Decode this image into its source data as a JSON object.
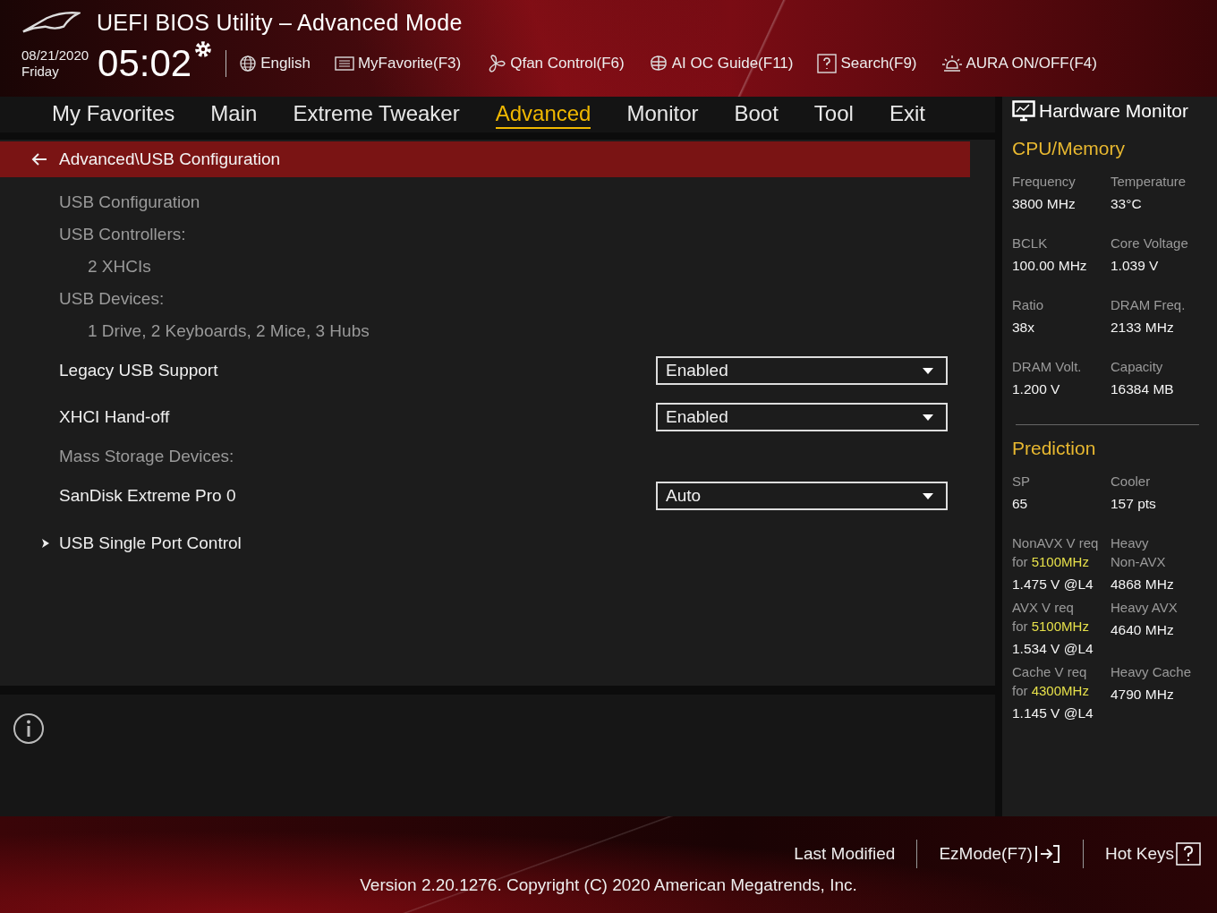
{
  "header": {
    "title": "UEFI BIOS Utility – Advanced Mode",
    "date": "08/21/2020",
    "day": "Friday",
    "time": "05:02",
    "tools": [
      {
        "label": "English"
      },
      {
        "label": "MyFavorite(F3)"
      },
      {
        "label": "Qfan Control(F6)"
      },
      {
        "label": "AI OC Guide(F11)"
      },
      {
        "label": "Search(F9)"
      },
      {
        "label": "AURA ON/OFF(F4)"
      }
    ]
  },
  "tabs": [
    {
      "label": "My Favorites",
      "selected": false
    },
    {
      "label": "Main",
      "selected": false
    },
    {
      "label": "Extreme Tweaker",
      "selected": false
    },
    {
      "label": "Advanced",
      "selected": true
    },
    {
      "label": "Monitor",
      "selected": false
    },
    {
      "label": "Boot",
      "selected": false
    },
    {
      "label": "Tool",
      "selected": false
    },
    {
      "label": "Exit",
      "selected": false
    }
  ],
  "breadcrumb": "Advanced\\USB Configuration",
  "items": [
    {
      "kind": "heading",
      "label": "USB Configuration"
    },
    {
      "kind": "heading",
      "label": "USB Controllers:",
      "children": [
        {
          "label": "2 XHCIs"
        }
      ]
    },
    {
      "kind": "heading",
      "label": "USB Devices:",
      "children": [
        {
          "label": "1 Drive, 2 Keyboards, 2 Mice, 3 Hubs"
        }
      ]
    },
    {
      "kind": "setting",
      "label": "Legacy USB Support",
      "value": "Enabled"
    },
    {
      "kind": "setting",
      "label": "XHCI Hand-off",
      "value": "Enabled"
    },
    {
      "kind": "heading",
      "label": "Mass Storage Devices:"
    },
    {
      "kind": "setting",
      "label": "SanDisk Extreme Pro 0",
      "value": "Auto"
    },
    {
      "kind": "submenu",
      "label": "USB Single Port Control"
    }
  ],
  "monitor": {
    "title": "Hardware Monitor",
    "sections": [
      {
        "title": "CPU/Memory",
        "cells": [
          {
            "label": [
              "Frequency"
            ],
            "value": "3800 MHz"
          },
          {
            "label": [
              "Temperature"
            ],
            "value": "33°C"
          },
          {
            "label": [
              "BCLK"
            ],
            "value": "100.00 MHz"
          },
          {
            "label": [
              "Core Voltage"
            ],
            "value": "1.039 V"
          },
          {
            "label": [
              "Ratio"
            ],
            "value": "38x"
          },
          {
            "label": [
              "DRAM Freq."
            ],
            "value": "2133 MHz"
          },
          {
            "label": [
              "DRAM Volt."
            ],
            "value": "1.200 V"
          },
          {
            "label": [
              "Capacity"
            ],
            "value": "16384 MB"
          }
        ]
      },
      {
        "title": "Prediction",
        "cells": [
          {
            "label": [
              "SP"
            ],
            "value": "65"
          },
          {
            "label": [
              "Cooler"
            ],
            "value": "157 pts"
          },
          {
            "label": [
              "NonAVX V req",
              "for **5100MHz**"
            ],
            "value": "1.475 V @L4"
          },
          {
            "label": [
              "Heavy",
              "Non-AVX"
            ],
            "value": "4868 MHz"
          },
          {
            "label": [
              "AVX V req",
              "for **5100MHz**"
            ],
            "value": "1.534 V @L4"
          },
          {
            "label": [
              "Heavy AVX"
            ],
            "value": "4640 MHz"
          },
          {
            "label": [
              "Cache V req",
              "for **4300MHz**"
            ],
            "value": "1.145 V @L4"
          },
          {
            "label": [
              "Heavy Cache"
            ],
            "value": "4790 MHz"
          }
        ]
      }
    ]
  },
  "footer": {
    "links": [
      {
        "label": "Last Modified"
      },
      {
        "label": "EzMode(F7)"
      },
      {
        "label": "Hot Keys"
      }
    ],
    "version": "Version 2.20.1276. Copyright (C) 2020 American Megatrends, Inc."
  }
}
